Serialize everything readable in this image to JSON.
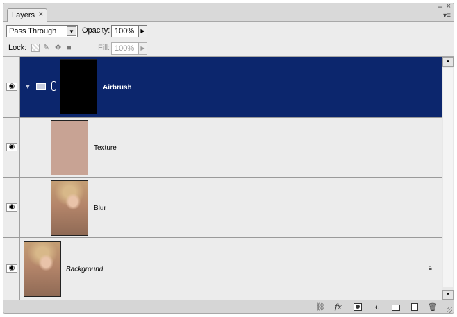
{
  "panel": {
    "tab_label": "Layers",
    "tab_close": "×",
    "minimize_glyph": "–",
    "close_glyph": "×",
    "menu_glyph": "▾≡"
  },
  "options": {
    "blend_mode": "Pass Through",
    "opacity_label": "Opacity:",
    "opacity_value": "100%",
    "lock_label": "Lock:",
    "fill_label": "Fill:",
    "fill_value": "100%"
  },
  "layers": [
    {
      "name": "Airbrush",
      "type": "group",
      "selected": true,
      "thumb_color": "#000000"
    },
    {
      "name": "Texture",
      "type": "layer",
      "selected": false,
      "thumb_color": "#c8a394"
    },
    {
      "name": "Blur",
      "type": "layer",
      "selected": false,
      "thumb": "portrait"
    },
    {
      "name": "Background",
      "type": "background",
      "selected": false,
      "thumb": "portrait",
      "locked": true
    }
  ],
  "icons": {
    "eye": "eye-icon",
    "expand": "triangle-down-icon",
    "folder": "folder-icon",
    "chain": "chain-link-icon",
    "lock": "lock-icon",
    "link_layers": "link-icon",
    "fx": "fx",
    "mask": "layer-mask-icon",
    "adjustment": "adjustment-layer-icon",
    "new_group": "new-group-icon",
    "new_layer": "new-layer-icon",
    "delete": "trash-icon"
  },
  "colors": {
    "selection": "#0c266d",
    "panel_bg": "#ececec"
  }
}
